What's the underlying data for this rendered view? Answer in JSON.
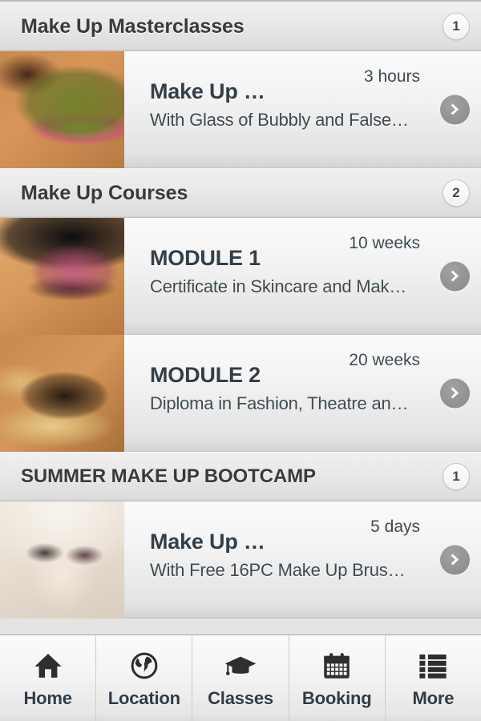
{
  "sections": [
    {
      "title": "Make Up Masterclasses",
      "count": "1",
      "items": [
        {
          "title": "Make Up …",
          "subtitle": "With Glass of Bubbly and False…",
          "duration": "3 hours",
          "thumb": "eye-green-eyeshadow-photo"
        }
      ]
    },
    {
      "title": "Make Up Courses",
      "count": "2",
      "items": [
        {
          "title": "MODULE 1",
          "subtitle": "Certificate in Skincare and Mak…",
          "duration": "10 weeks",
          "thumb": "eye-glitter-lashes-photo"
        },
        {
          "title": "MODULE 2",
          "subtitle": "Diploma in Fashion, Theatre an…",
          "duration": "20 weeks",
          "thumb": "eye-gold-flakes-photo"
        }
      ]
    },
    {
      "title": "SUMMER MAKE UP BOOTCAMP",
      "count": "1",
      "items": [
        {
          "title": "Make Up …",
          "subtitle": "With Free 16PC Make Up Brus…",
          "duration": "5 days",
          "thumb": "model-white-hair-photo"
        }
      ]
    }
  ],
  "tabbar": {
    "tabs": [
      {
        "label": "Home",
        "icon": "home-icon"
      },
      {
        "label": "Location",
        "icon": "globe-icon"
      },
      {
        "label": "Classes",
        "icon": "graduation-cap-icon"
      },
      {
        "label": "Booking",
        "icon": "calendar-icon"
      },
      {
        "label": "More",
        "icon": "list-icon"
      }
    ]
  },
  "icons": {
    "row_chevron": "chevron-right-icon"
  },
  "colors": {
    "text_primary": "#333f48",
    "text_secondary": "#3e4a52",
    "header_text": "#3a3a3a",
    "chevron_circle": "#949494",
    "tab_label": "#2f3b46"
  }
}
